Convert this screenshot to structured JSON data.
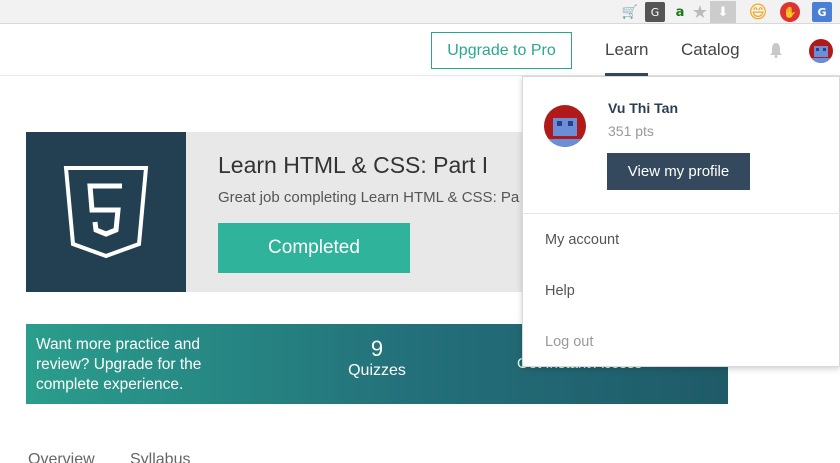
{
  "extensions": {
    "cart_glyph": "🛒",
    "translate_glyph": "G",
    "amazon_glyph": "a",
    "star_glyph": "★",
    "download_glyph": "⬇",
    "emoji_glyph": "😄",
    "block_glyph": "✋",
    "gtranslate_glyph": "G"
  },
  "header": {
    "upgrade_label": "Upgrade to Pro",
    "nav_learn": "Learn",
    "nav_catalog": "Catalog",
    "bell_glyph": "🔔"
  },
  "course": {
    "title": "Learn HTML & CSS: Part I",
    "subtitle": "Great job completing Learn HTML & CSS: Pa",
    "button_label": "Completed",
    "icon": "html5-shield-icon"
  },
  "promo": {
    "text": "Want more practice and review? Upgrade for the complete experience.",
    "quiz_count": "9",
    "quiz_label": "Quizzes",
    "instant_label": "Get Instant Access »"
  },
  "tabs": {
    "overview": "Overview",
    "syllabus": "Syllabus"
  },
  "dropdown": {
    "name": "Vu Thi Tan",
    "points": "351 pts",
    "profile_button": "View my profile",
    "items": [
      "My account",
      "Help",
      "Log out"
    ]
  },
  "colors": {
    "accent": "#2fb39a",
    "dark": "#34495e",
    "course_icon_bg": "#233f52"
  }
}
